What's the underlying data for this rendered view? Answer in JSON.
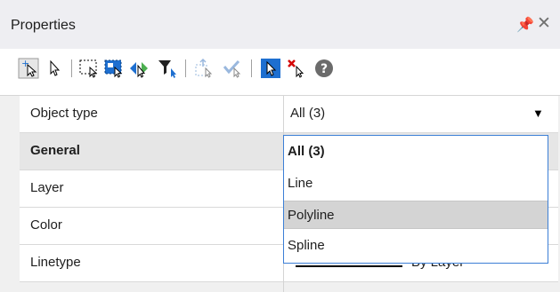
{
  "panel": {
    "title": "Properties",
    "pin_icon": "pin-icon",
    "close_icon": "close-icon"
  },
  "toolbar": {
    "buttons": [
      "add-to-selection-icon",
      "select-pointer-icon",
      "window-selection-icon",
      "crossing-selection-icon",
      "toggle-selection-icon",
      "filter-selection-icon",
      "move-selection-icon",
      "accept-selection-icon",
      "pick-mode-icon",
      "clear-selection-icon",
      "help-icon"
    ]
  },
  "grid": {
    "rows": [
      {
        "label": "Object type",
        "value": "All (3)",
        "kind": "combo"
      },
      {
        "label": "General",
        "kind": "category"
      },
      {
        "label": "Layer"
      },
      {
        "label": "Color"
      },
      {
        "label": "Linetype",
        "value": "By Layer",
        "kind": "linetype"
      }
    ]
  },
  "dropdown": {
    "items": [
      "All (3)",
      "Line",
      "Polyline",
      "Spline"
    ],
    "selected_index": 2,
    "bold_index": 0
  },
  "colors": {
    "accent": "#3c7fd6",
    "toolbar_blue": "#1e6fd0",
    "toolbar_red": "#d40000"
  }
}
